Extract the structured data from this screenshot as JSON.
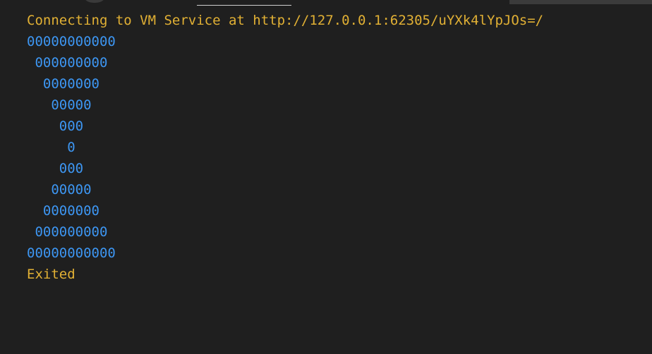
{
  "console": {
    "connect_message": "Connecting to VM Service at http://127.0.0.1:62305/uYXk4lYpJOs=/",
    "output_lines": [
      "00000000000",
      " 000000000",
      "  0000000",
      "   00000",
      "    000",
      "     0",
      "    000",
      "   00000",
      "  0000000",
      " 000000000",
      "00000000000"
    ],
    "exit_message": "Exited"
  },
  "colors": {
    "background": "#1f1f1f",
    "info_text": "#e1b034",
    "output_text": "#3d96f2"
  }
}
